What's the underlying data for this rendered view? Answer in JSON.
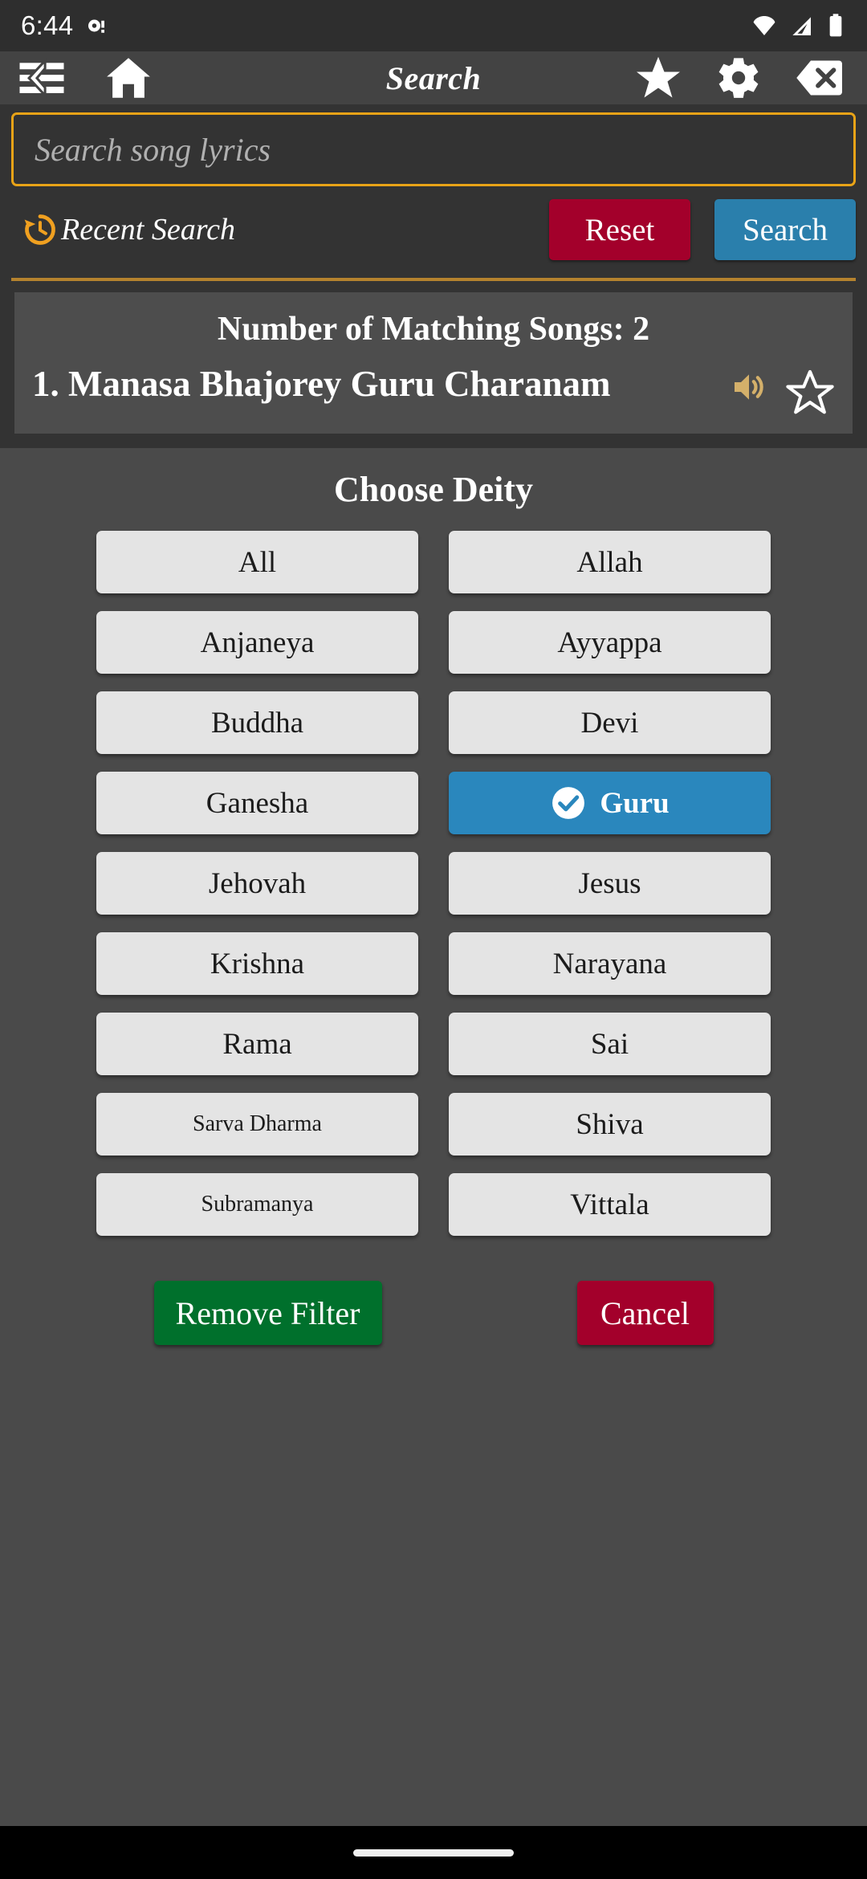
{
  "status_bar": {
    "time": "6:44",
    "left_icons": [
      "notification-dot-icon"
    ],
    "right_icons": [
      "wifi-icon",
      "cell-signal-icon",
      "battery-icon"
    ]
  },
  "toolbar": {
    "title": "Search",
    "menu_icon": "hamburger-menu-icon",
    "home_icon": "home-icon",
    "favorite_icon": "star-filled-icon",
    "settings_icon": "gear-icon",
    "clear_icon": "clear-x-icon"
  },
  "search": {
    "placeholder": "Search song lyrics",
    "value": "",
    "border_color": "#E8A317",
    "recent_label": "Recent Search",
    "recent_icon": "history-clock-icon",
    "reset_label": "Reset",
    "reset_color": "#A3002B",
    "search_label": "Search",
    "search_color": "#2A7FAC"
  },
  "results": {
    "match_count_label": "Number of Matching Songs: 2",
    "songs": [
      {
        "title": "1. Manasa Bhajorey Guru Charanam",
        "audio_icon": "speaker-volume-icon",
        "favorite_icon": "star-outline-icon"
      }
    ]
  },
  "deity_sheet": {
    "title": "Choose Deity",
    "selected": "Guru",
    "selected_color": "#2A87BD",
    "check_icon": "check-circle-icon",
    "options": [
      {
        "label": "All",
        "selected": false,
        "small": false
      },
      {
        "label": "Allah",
        "selected": false,
        "small": false
      },
      {
        "label": "Anjaneya",
        "selected": false,
        "small": false
      },
      {
        "label": "Ayyappa",
        "selected": false,
        "small": false
      },
      {
        "label": "Buddha",
        "selected": false,
        "small": false
      },
      {
        "label": "Devi",
        "selected": false,
        "small": false
      },
      {
        "label": "Ganesha",
        "selected": false,
        "small": false
      },
      {
        "label": "Guru",
        "selected": true,
        "small": false
      },
      {
        "label": "Jehovah",
        "selected": false,
        "small": false
      },
      {
        "label": "Jesus",
        "selected": false,
        "small": false
      },
      {
        "label": "Krishna",
        "selected": false,
        "small": false
      },
      {
        "label": "Narayana",
        "selected": false,
        "small": false
      },
      {
        "label": "Rama",
        "selected": false,
        "small": false
      },
      {
        "label": "Sai",
        "selected": false,
        "small": false
      },
      {
        "label": "Sarva Dharma",
        "selected": false,
        "small": true
      },
      {
        "label": "Shiva",
        "selected": false,
        "small": false
      },
      {
        "label": "Subramanya",
        "selected": false,
        "small": true
      },
      {
        "label": "Vittala",
        "selected": false,
        "small": false
      }
    ],
    "remove_filter_label": "Remove Filter",
    "remove_filter_color": "#00702C",
    "cancel_label": "Cancel",
    "cancel_color": "#A3002B"
  },
  "nav_bar": {
    "handle": "home-gesture-handle"
  }
}
